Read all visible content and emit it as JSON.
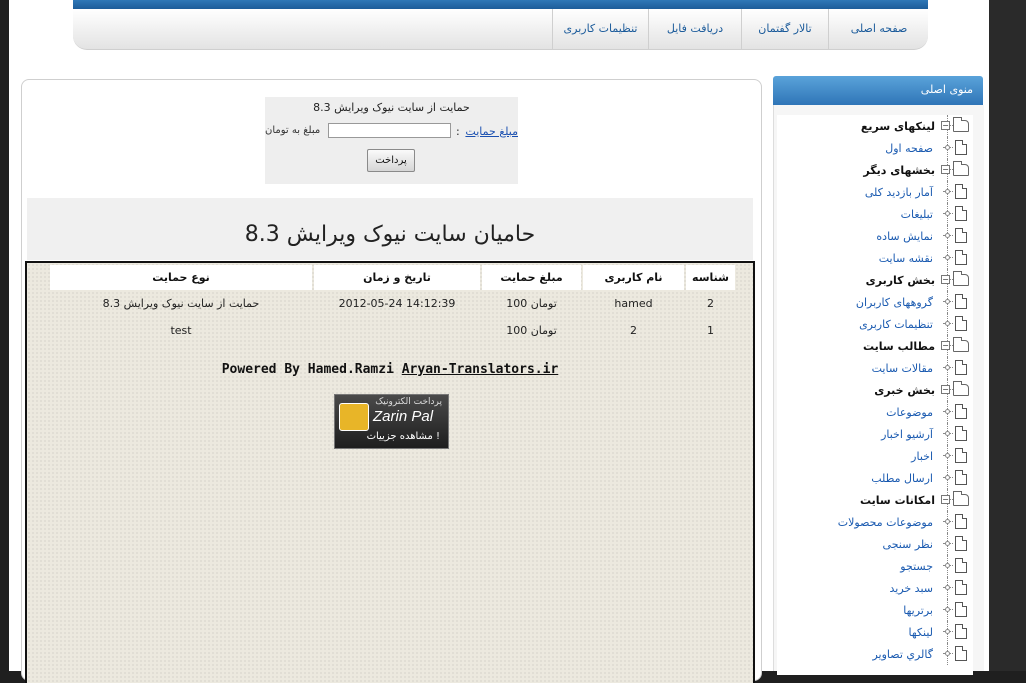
{
  "nav": {
    "items": [
      {
        "label": "صفحه اصلی"
      },
      {
        "label": "تالار گفتمان"
      },
      {
        "label": "دریافت فایل"
      },
      {
        "label": "تنظیمات کاربری"
      }
    ]
  },
  "donate": {
    "title": "حمایت از سایت نیوک ویرایش 8.3",
    "amount_label": "مبلغ حمایت",
    "amount_colon": ":",
    "amount_value": "",
    "amount_unit": "مبلغ به تومان",
    "pay_button": "پرداخت"
  },
  "sponsors": {
    "title": "حامیان سایت نیوک ویرایش 8.3",
    "columns": [
      "شناسه",
      "نام کاربری",
      "مبلغ حمایت",
      "تاریخ و زمان",
      "نوع حمایت"
    ],
    "rows": [
      {
        "id": "2",
        "user": "hamed",
        "amount": "100 تومان",
        "datetime": "2012-05-24 14:12:39",
        "type": "حمایت از سایت نیوک ویرایش 8.3"
      },
      {
        "id": "1",
        "user": "2",
        "amount": "100 تومان",
        "datetime": "",
        "type": "test"
      }
    ],
    "powered_prefix": "Powered By Hamed.Ramzi ",
    "powered_link": "Aryan-Translators.ir",
    "badge": {
      "top": "پرداخت الکترونیک",
      "name": "Zarin Pal",
      "details": "مشاهده جزییات !"
    }
  },
  "sidebar": {
    "title": "منوی اصلی",
    "tree": [
      {
        "label": "لینکهای سریع",
        "kind": "cat"
      },
      {
        "label": "صفحه اول",
        "kind": "leaf"
      },
      {
        "label": "بخشهای دیگر",
        "kind": "cat"
      },
      {
        "label": "آمار بازدید کلی",
        "kind": "leaf"
      },
      {
        "label": "تبلیغات",
        "kind": "leaf"
      },
      {
        "label": "نمایش ساده",
        "kind": "leaf"
      },
      {
        "label": "نقشه سایت",
        "kind": "leaf"
      },
      {
        "label": "بخش کاربری",
        "kind": "cat"
      },
      {
        "label": "گروههای کاربران",
        "kind": "leaf"
      },
      {
        "label": "تنظیمات کاربری",
        "kind": "leaf"
      },
      {
        "label": "مطالب سایت",
        "kind": "cat"
      },
      {
        "label": "مقالات سایت",
        "kind": "leaf"
      },
      {
        "label": "بخش خبری",
        "kind": "cat"
      },
      {
        "label": "موضوعات",
        "kind": "leaf"
      },
      {
        "label": "آرشیو اخبار",
        "kind": "leaf"
      },
      {
        "label": "اخبار",
        "kind": "leaf"
      },
      {
        "label": "ارسال مطلب",
        "kind": "leaf"
      },
      {
        "label": "امکانات سایت",
        "kind": "cat"
      },
      {
        "label": "موضوعات محصولات",
        "kind": "leaf"
      },
      {
        "label": "نظر سنجی",
        "kind": "leaf"
      },
      {
        "label": "جستجو",
        "kind": "leaf"
      },
      {
        "label": "سبد خرید",
        "kind": "leaf"
      },
      {
        "label": "برتریها",
        "kind": "leaf"
      },
      {
        "label": "لینکها",
        "kind": "leaf"
      },
      {
        "label": "گالري تصاویر",
        "kind": "leaf"
      }
    ]
  }
}
